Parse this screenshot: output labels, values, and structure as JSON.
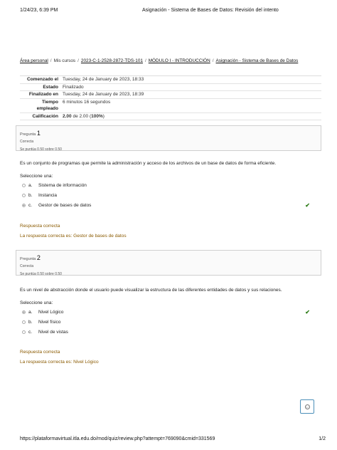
{
  "print_header": {
    "datetime": "1/24/23, 6:39 PM",
    "title": "Asignación - Sistema de Bases de Datos: Revisión del intento"
  },
  "breadcrumb": {
    "items": [
      "Área personal",
      "Mis cursos",
      "2023-C-1-2528-2872-TDS-101",
      "MÓDULO I - INTRODUCCIÓN",
      "Asignación - Sistema de Bases de Datos"
    ],
    "separator": "/"
  },
  "summary": {
    "rows": [
      {
        "label": "Comenzado el",
        "value": "Tuesday, 24 de January de 2023, 18:33"
      },
      {
        "label": "Estado",
        "value": "Finalizado"
      },
      {
        "label": "Finalizado en",
        "value": "Tuesday, 24 de January de 2023, 18:39"
      },
      {
        "label": "Tiempo empleado",
        "value": "6 minutos 16 segundos"
      },
      {
        "label": "Calificación",
        "value_bold": "2.00",
        "value_mid": " de 2.00 (",
        "value_pct": "100%",
        "value_end": ")"
      }
    ]
  },
  "questions": [
    {
      "label": "Pregunta",
      "number": "1",
      "state": "Correcta",
      "grade": "Se puntúa 0.50 sobre 0.50",
      "text": "Es un conjunto de programas que permite la administración y acceso de los archivos de un base de datos de forma eficiente.",
      "prompt": "Seleccione una:",
      "options": [
        {
          "letter": "a.",
          "text": "Sistema de información",
          "selected": false
        },
        {
          "letter": "b.",
          "text": "Instancia",
          "selected": false
        },
        {
          "letter": "c.",
          "text": "Gestor de bases de datos",
          "selected": true
        }
      ],
      "feedback_result": "Respuesta correcta",
      "feedback_answer": "La respuesta correcta es: Gestor de bases de datos"
    },
    {
      "label": "Pregunta",
      "number": "2",
      "state": "Correcta",
      "grade": "Se puntúa 0.50 sobre 0.50",
      "text": "Es un nivel de abstracción donde el usuario puede visualizar la estructura de las diferentes entidades de datos y sus relaciones.",
      "prompt": "Seleccione una:",
      "options": [
        {
          "letter": "a.",
          "text": "Nivel Lógico",
          "selected": true
        },
        {
          "letter": "b.",
          "text": "Nivel físico",
          "selected": false
        },
        {
          "letter": "c.",
          "text": "Nivel de vistas",
          "selected": false
        }
      ],
      "feedback_result": "Respuesta correcta",
      "feedback_answer": "La respuesta correcta es: Nivel Lógico"
    }
  ],
  "icons": {
    "correct": "check-icon",
    "fab": "smiley-icon"
  },
  "colors": {
    "correct": "#2f7d1a",
    "feedback": "#8a5a00",
    "fab_border": "#4b8fb9"
  },
  "print_footer": {
    "url": "https://plataformavirtual.itla.edu.do/mod/quiz/review.php?attempt=769090&cmid=331569",
    "page": "1/2"
  }
}
